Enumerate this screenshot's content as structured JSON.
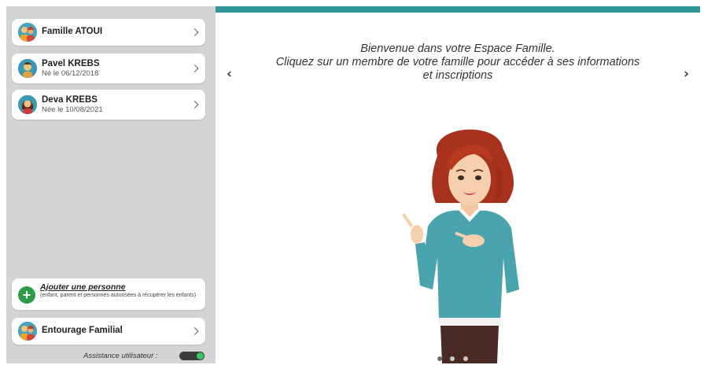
{
  "sidebar": {
    "family": {
      "name": "Famille ATOUI"
    },
    "members": [
      {
        "name": "Pavel KREBS",
        "subtitle": "Né le 06/12/2018"
      },
      {
        "name": "Deva KREBS",
        "subtitle": "Née le 10/08/2021"
      }
    ],
    "add_person": {
      "label": "Ajouter une personne",
      "note": "(enfant, parent et personnes autorisées à récupérer les enfants)"
    },
    "entourage": {
      "name": "Entourage Familial"
    },
    "assistance": {
      "label": "Assistance utilisateur :",
      "enabled": true
    }
  },
  "main": {
    "welcome_line1": "Bienvenue dans votre Espace Famille.",
    "welcome_line2": "Cliquez sur un membre de votre famille pour accéder à ses informations",
    "welcome_line3": "et inscriptions",
    "prev_arrow": "‹",
    "next_arrow": "›"
  },
  "colors": {
    "accent": "#2e9796",
    "sidebar_bg": "#d4d4d4",
    "toggle_on": "#3cc46b",
    "add_button": "#2e9b46"
  },
  "icons": [
    "family-avatar-icon",
    "boy-avatar-icon",
    "girl-avatar-icon",
    "plus-icon",
    "chevron-right-icon",
    "chevron-left-icon"
  ]
}
